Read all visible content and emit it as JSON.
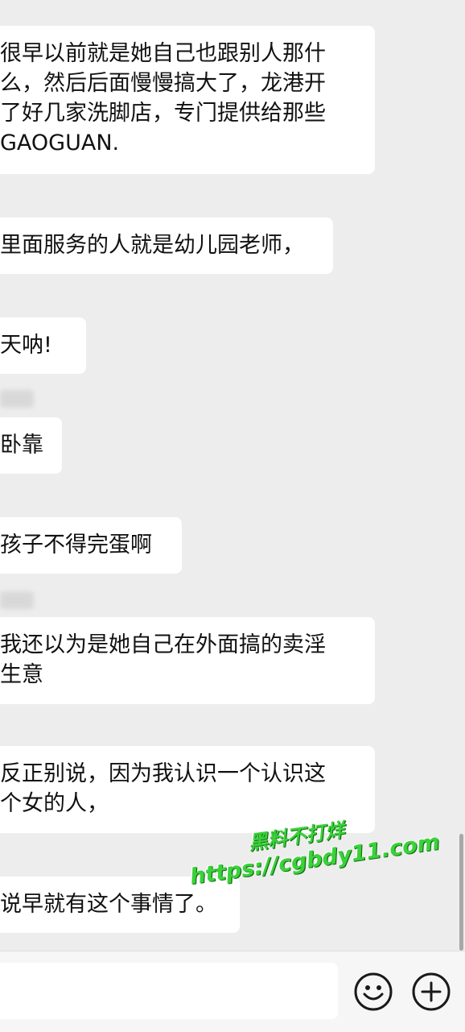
{
  "messages": [
    {
      "text": "很早以前就是她自己也跟别人那什\n么，然后后面慢慢搞大了，龙港开\n了好几家洗脚店，专门提供给那些\nGAOGUAN."
    },
    {
      "text": "里面服务的人就是幼儿园老师，"
    },
    {
      "text": "天呐!"
    },
    {
      "text": "卧靠"
    },
    {
      "text": "孩子不得完蛋啊"
    },
    {
      "text": "我还以为是她自己在外面搞的卖淫\n生意"
    },
    {
      "text": "反正别说，因为我认识一个认识这\n个女的人，"
    },
    {
      "text": "说早就有这个事情了。"
    }
  ],
  "watermark": {
    "line1": "黑料不打烊",
    "line2": "https://cgbdy11.com"
  },
  "toolbar": {
    "emoji_icon": "smiley-face-icon",
    "plus_icon": "plus-circle-icon"
  },
  "colors": {
    "background": "#ededed",
    "bubble": "#ffffff",
    "watermark": "#3ad23a"
  }
}
